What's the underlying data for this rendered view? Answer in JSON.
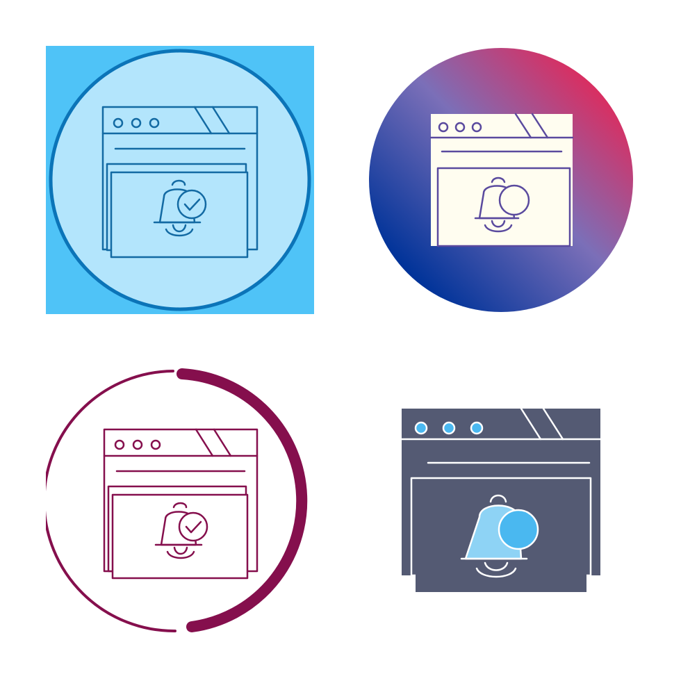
{
  "icons": [
    {
      "name": "browser-notification-line-icon",
      "style": "lineal",
      "background": "square-with-circle",
      "colors": {
        "square": "#4fc3f7",
        "circle_fill": "#b3e5fc",
        "circle_stroke": "#0b74b8",
        "line": "#136aa3"
      },
      "badge": "check"
    },
    {
      "name": "browser-notification-gradient-icon",
      "style": "glyph-on-gradient",
      "background": "gradient-circle",
      "colors": {
        "gradient_start": "#003399",
        "gradient_mid": "#7b6fb8",
        "gradient_end": "#d82f62",
        "glyph": "#fffdf0",
        "line": "#5a4a9e"
      },
      "badge": "dot"
    },
    {
      "name": "browser-notification-ring-icon",
      "style": "lineal",
      "background": "broken-ring",
      "colors": {
        "ring": "#850f4d",
        "line": "#850f4d"
      },
      "badge": "check"
    },
    {
      "name": "browser-notification-glyph-icon",
      "style": "glyph",
      "background": "none",
      "colors": {
        "body": "#545a73",
        "accent": "#4ab8f0",
        "line": "#ffffff"
      },
      "badge": "dot"
    }
  ]
}
